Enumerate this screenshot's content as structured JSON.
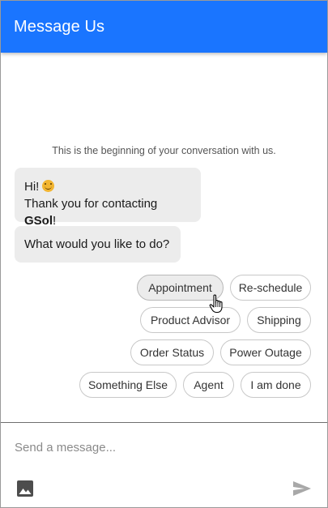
{
  "header": {
    "title": "Message Us"
  },
  "conversation": {
    "start_notice": "This is the beginning of your conversation with us.",
    "messages": [
      {
        "line1": "Hi!",
        "emoji": "smiling-face-icon",
        "line2_prefix": "Thank you for contacting ",
        "line2_brand": "GSol",
        "line2_suffix": "!"
      },
      {
        "text": "What would you like to do?"
      }
    ]
  },
  "quick_replies": [
    {
      "label": "Appointment"
    },
    {
      "label": "Re-schedule"
    },
    {
      "label": "Product Advisor"
    },
    {
      "label": "Shipping"
    },
    {
      "label": "Order Status"
    },
    {
      "label": "Power Outage"
    },
    {
      "label": "Something Else"
    },
    {
      "label": "Agent"
    },
    {
      "label": "I am done"
    }
  ],
  "composer": {
    "placeholder": "Send a message...",
    "value": "",
    "image_icon": "image-icon",
    "send_icon": "send-icon"
  },
  "colors": {
    "header": "#1a75ff",
    "bubble": "#ececec",
    "chip_border": "#c8c8c8"
  }
}
